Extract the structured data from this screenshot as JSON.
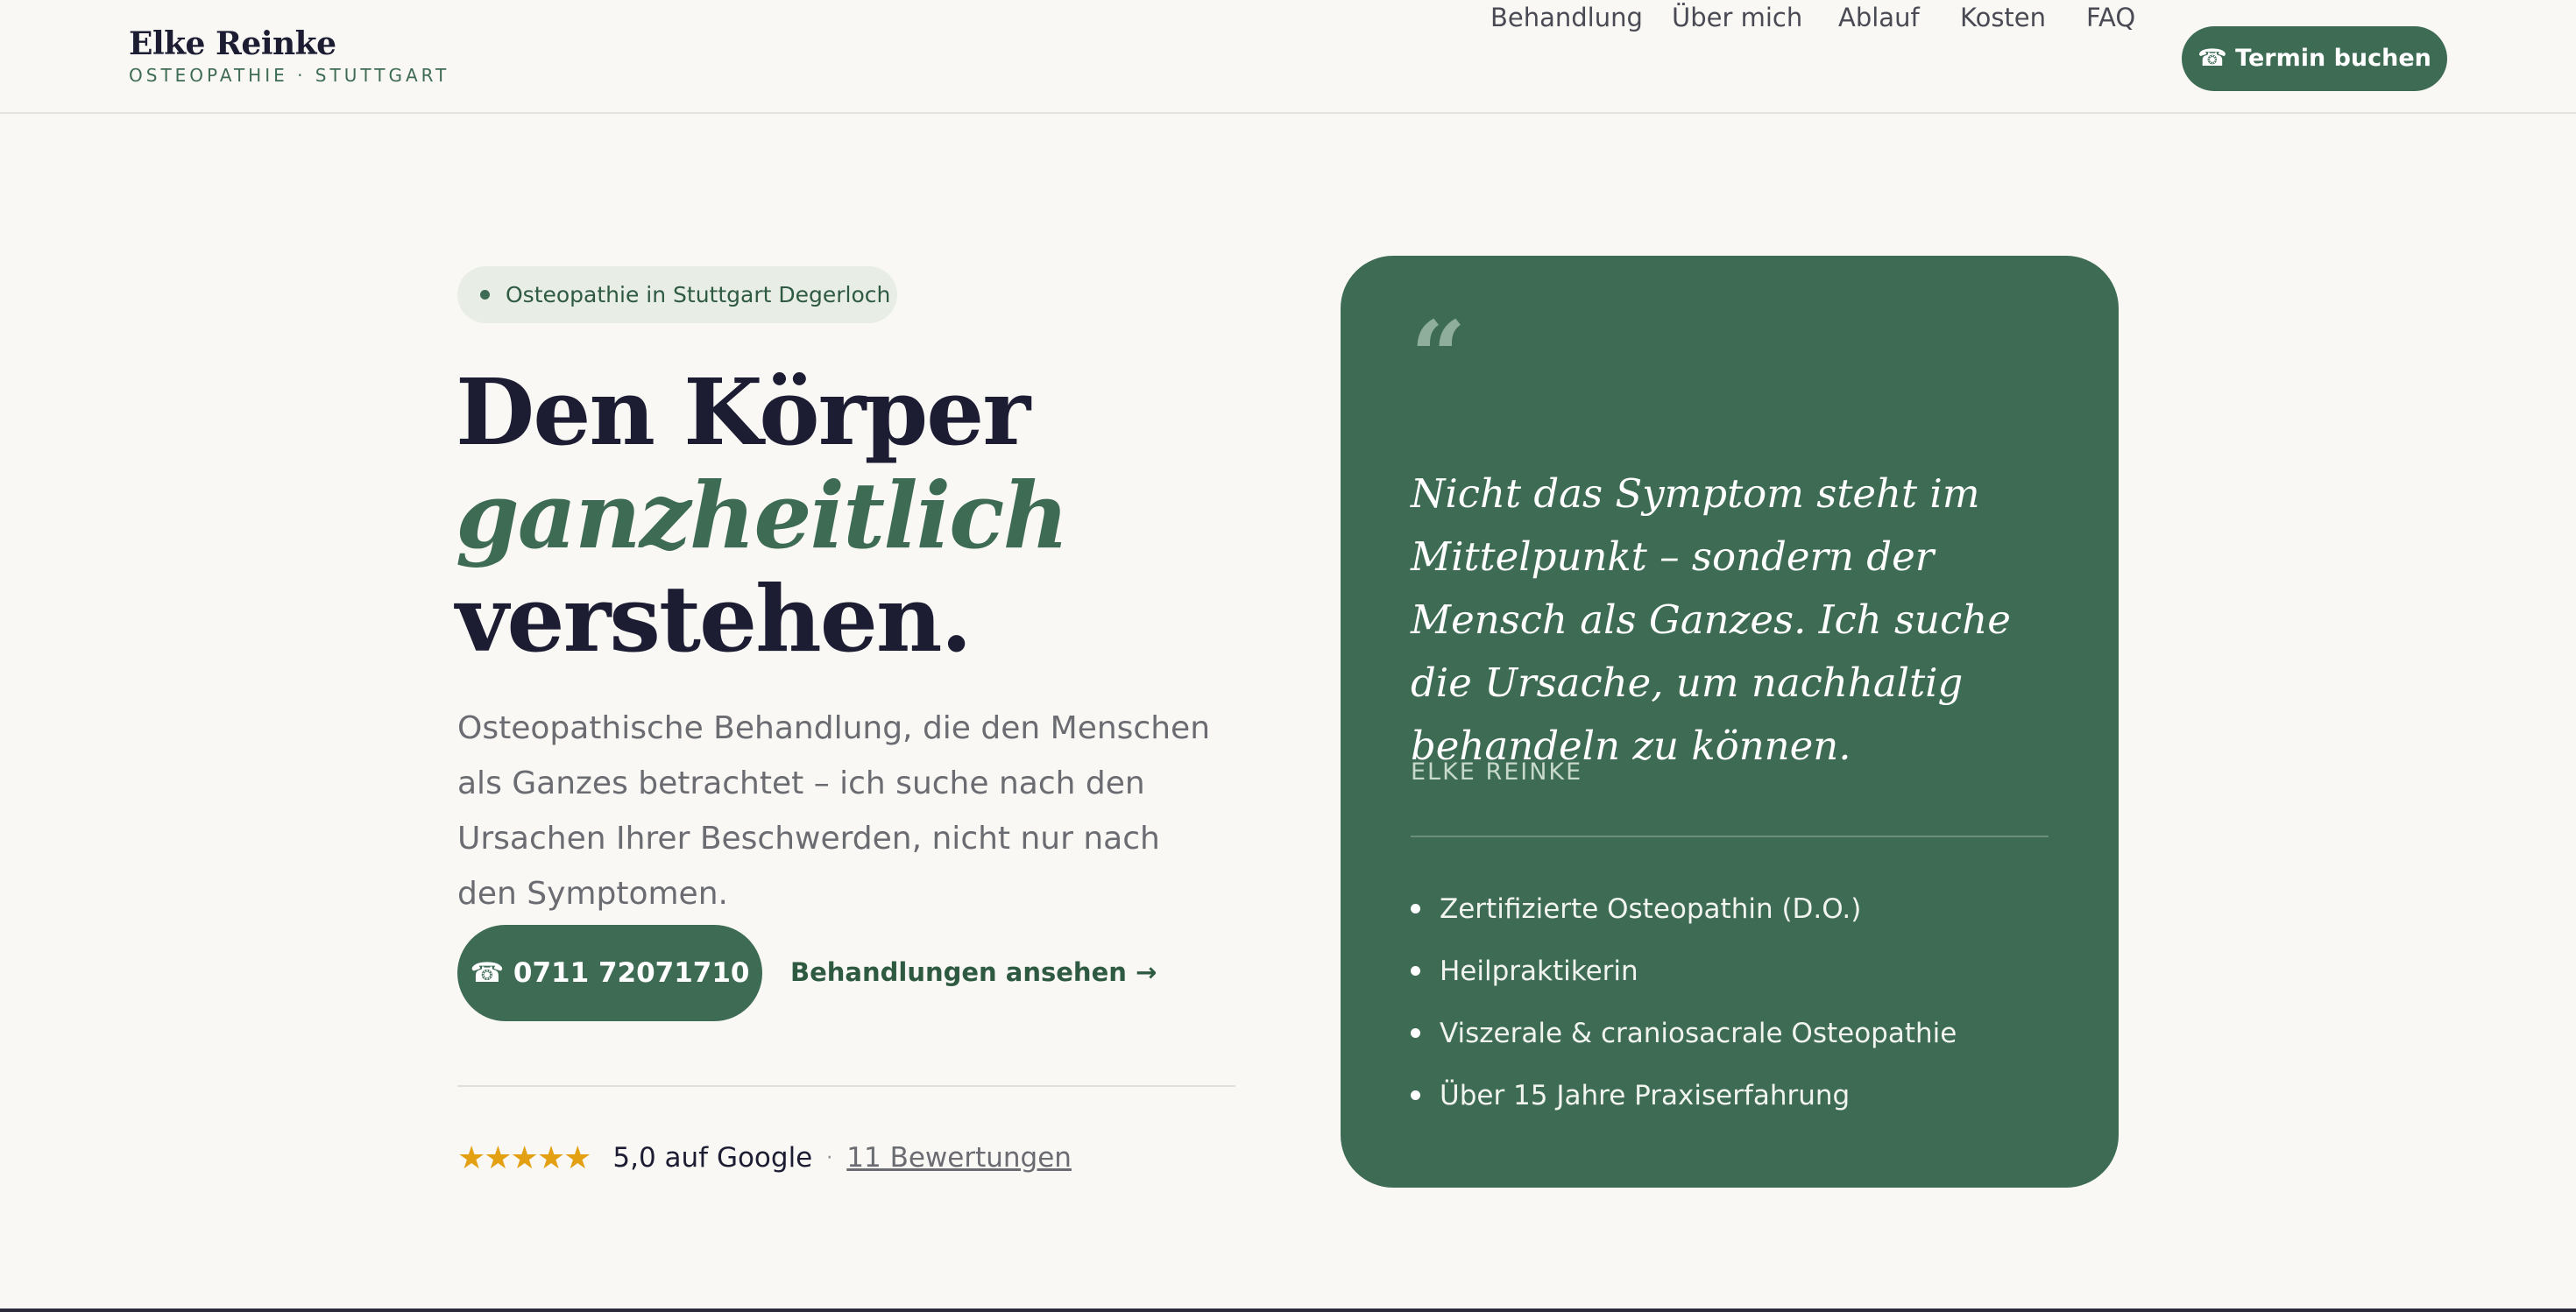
{
  "brand": {
    "name": "Elke Reinke",
    "subtitle": "OSTEOPATHIE · STUTTGART"
  },
  "nav": {
    "items": [
      {
        "label": "Behandlung"
      },
      {
        "label": "Über mich"
      },
      {
        "label": "Ablauf"
      },
      {
        "label": "Kosten"
      },
      {
        "label": "FAQ"
      }
    ],
    "cta_label": "☎ Termin buchen"
  },
  "hero": {
    "badge": "Osteopathie in Stuttgart Degerloch",
    "headline_line1": "Den Körper",
    "headline_accent": "ganzheitlich",
    "headline_line3": "verstehen.",
    "lead": "Osteopathische Behandlung, die den Menschen als Ganzes betrachtet – ich suche nach den Ursachen Ihrer Beschwerden, nicht nur nach den Symptomen.",
    "phone_button": "☎ 0711 72071710",
    "treatments_link": "Behandlungen ansehen →",
    "rating": {
      "stars": "★★★★★",
      "star_count": 5,
      "score_text": "5,0 auf Google",
      "separator": "·",
      "reviews_link": "11 Bewertungen"
    }
  },
  "card": {
    "quote_mark": "“",
    "quote": "Nicht das Symptom steht im Mittelpunkt – sondern der Mensch als Ganzes. Ich suche die Ursache, um nachhaltig behandeln zu können.",
    "author": "ELKE REINKE",
    "credentials": [
      "Zertifizierte Osteopathin (D.O.)",
      "Heilpraktikerin",
      "Viszerale & craniosacrale Osteopathie",
      "Über 15 Jahre Praxiserfahrung"
    ]
  },
  "colors": {
    "brand_green": "#3e6b53",
    "star_gold": "#e2a012",
    "background": "#f9f8f4",
    "ink": "#1c1c33"
  }
}
